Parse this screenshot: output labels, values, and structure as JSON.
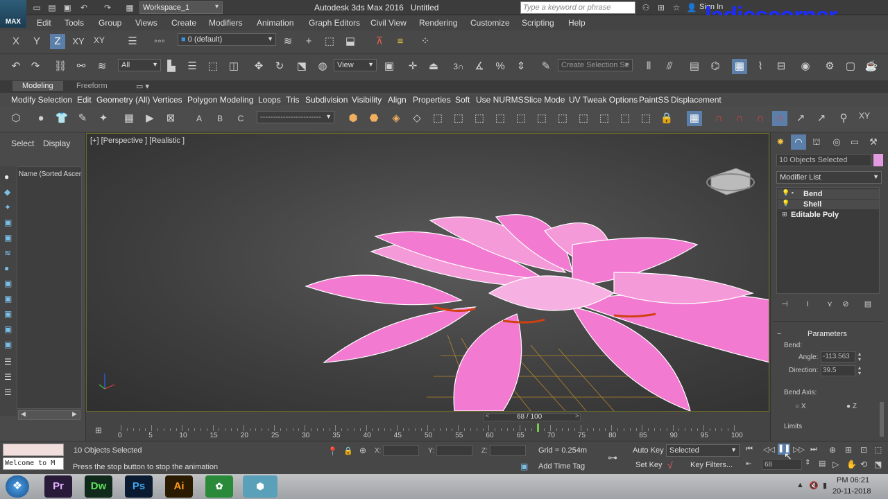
{
  "titlebar": {
    "app_logo": "MAX",
    "workspace": "Workspace_1",
    "app_name": "Autodesk 3ds Max 2016",
    "doc_name": "Untitled",
    "search_placeholder": "Type a keyword or phrase",
    "signin": "Sign In",
    "watermark": "ladiescorner"
  },
  "menus": [
    "Edit",
    "Tools",
    "Group",
    "Views",
    "Create",
    "Modifiers",
    "Animation",
    "Graph Editors",
    "Civil View",
    "Rendering",
    "Customize",
    "Scripting",
    "Help"
  ],
  "axis_toolbar": {
    "x": "X",
    "y": "Y",
    "z": "Z",
    "xy": "XY",
    "xy2": "XY",
    "layer": "0 (default)"
  },
  "main_toolbar": {
    "filter": "All",
    "refcoord": "View",
    "selection_set": "Create Selection Se"
  },
  "ribbon": {
    "tabs": [
      "Modeling",
      "Freeform"
    ],
    "items": [
      "Modify Selection",
      "Edit",
      "Geometry (All)",
      "Vertices",
      "Polygon Modeling",
      "Loops",
      "Tris",
      "Subdivision",
      "Visibility",
      "Align",
      "Properties",
      "Soft",
      "Use NURMS",
      "Slice Mode",
      "UV Tweak Options",
      "PaintSS",
      "Displacement"
    ]
  },
  "scene_explorer": {
    "tab_select": "Select",
    "tab_display": "Display",
    "column": "Name (Sorted Ascen"
  },
  "viewport": {
    "label": "[+] [Perspective ] [Realistic ]",
    "frame": "68 / 100"
  },
  "command_panel": {
    "selection": "10 Objects Selected",
    "modifier_list": "Modifier List",
    "stack": [
      "Bend",
      "Shell",
      "Editable Poly"
    ],
    "parameters_title": "Parameters",
    "bend_label": "Bend:",
    "angle_label": "Angle:",
    "angle_value": "-113.563",
    "direction_label": "Direction:",
    "direction_value": "39.5",
    "bend_axis_label": "Bend Axis:",
    "axis_x": "X",
    "axis_z": "Z",
    "limits_label": "Limits"
  },
  "timeline": {
    "ticks": [
      "0",
      "5",
      "10",
      "15",
      "20",
      "25",
      "30",
      "35",
      "40",
      "45",
      "50",
      "55",
      "60",
      "65",
      "70",
      "75",
      "80",
      "85",
      "90",
      "95",
      "100"
    ]
  },
  "status": {
    "maxscript": "Welcome to M",
    "selected": "10 Objects Selected",
    "prompt": "Press the stop button to stop the animation",
    "x_label": "X:",
    "y_label": "Y:",
    "z_label": "Z:",
    "grid": "Grid = 0.254m",
    "add_time_tag": "Add Time Tag",
    "auto_key": "Auto Key",
    "set_key": "Set Key",
    "key_mode": "Selected",
    "key_filters": "Key Filters...",
    "current_frame": "68"
  },
  "taskbar": {
    "apps": [
      "Pr",
      "Dw",
      "Ps",
      "Ai"
    ],
    "time": "PM 06:21",
    "date": "20-11-2018"
  },
  "colors": {
    "accent": "#5b7fa8",
    "petal": "#f27ad0",
    "watermark": "#1c2cff"
  }
}
